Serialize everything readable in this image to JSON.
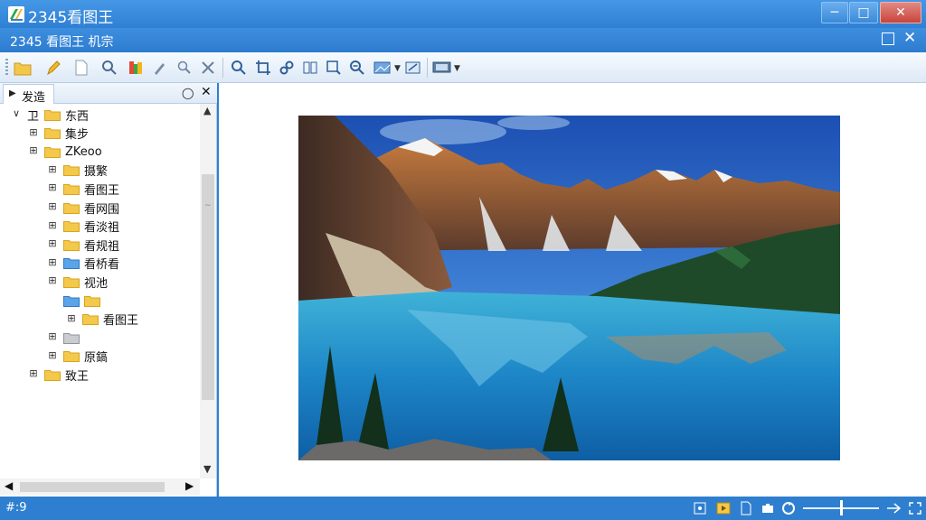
{
  "window": {
    "title": "2345看图王",
    "minimize_glyph": "─",
    "maximize_glyph": "□",
    "close_glyph": "✕"
  },
  "menubar": {
    "title": "2345 看图王   机宗"
  },
  "toolbar": {
    "icons": [
      "open-folder-icon",
      "edit-pen-icon",
      "new-page-icon",
      "search-icon",
      "color-icon",
      "brush-icon",
      "find-icon",
      "tools-icon",
      "zoom-in-icon",
      "crop-icon",
      "link-icon",
      "compare-icon",
      "zoom-fit-icon",
      "zoom-out-icon",
      "image-dropdown-icon",
      "export-icon",
      "screen-dropdown-icon"
    ]
  },
  "sidepanel": {
    "tab_label": "发造",
    "tree": [
      {
        "expander": "∨",
        "prefix": "卫",
        "label": "东西",
        "level": 0,
        "color": "yellow"
      },
      {
        "expander": "⊞",
        "label": "集步",
        "level": 1,
        "color": "yellow"
      },
      {
        "expander": "⊞",
        "label": "ZKeoo",
        "level": 1,
        "color": "yellow"
      },
      {
        "expander": "⊞",
        "label": "摄繁",
        "level": 2,
        "color": "yellow"
      },
      {
        "expander": "⊞",
        "label": "看图王",
        "level": 2,
        "color": "yellow"
      },
      {
        "expander": "⊞",
        "label": "看网围",
        "level": 2,
        "color": "yellow"
      },
      {
        "expander": "⊞",
        "label": "看淡祖",
        "level": 2,
        "color": "yellow"
      },
      {
        "expander": "⊞",
        "label": "看规祖",
        "level": 2,
        "color": "yellow"
      },
      {
        "expander": "⊞",
        "label": "看桥看",
        "level": 2,
        "color": "blue"
      },
      {
        "expander": "⊞",
        "label": "视池",
        "level": 2,
        "color": "yellow"
      },
      {
        "expander": "",
        "label": "",
        "level": 2,
        "color": "blue-yellow"
      },
      {
        "expander": "⊞",
        "label": "看图王",
        "level": 3,
        "color": "yellow"
      },
      {
        "expander": "⊞",
        "label": "",
        "level": 2,
        "color": "gray"
      },
      {
        "expander": "⊞",
        "label": "原鎬",
        "level": 2,
        "color": "yellow"
      },
      {
        "expander": "⊞",
        "label": "致王",
        "level": 1,
        "color": "yellow"
      }
    ]
  },
  "statusbar": {
    "left_text": "#:9",
    "zoom_fraction": 0.5
  },
  "colors": {
    "titlebar": "#3a8ad8",
    "folder_yellow": "#f3c84b",
    "folder_blue": "#5aa4e8"
  }
}
